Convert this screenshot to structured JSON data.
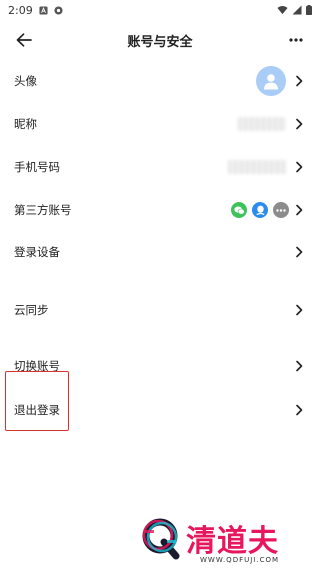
{
  "status_bar": {
    "time": "2:09"
  },
  "header": {
    "title": "账号与安全"
  },
  "rows": [
    {
      "label": "头像"
    },
    {
      "label": "昵称"
    },
    {
      "label": "手机号码"
    },
    {
      "label": "第三方账号"
    },
    {
      "label": "登录设备"
    },
    {
      "label": "云同步"
    },
    {
      "label": "切换账号"
    },
    {
      "label": "退出登录"
    }
  ],
  "third_party_icons": [
    "wechat-icon",
    "qq-icon",
    "more-dots-icon"
  ],
  "colors": {
    "wechat": "#3ec35c",
    "qq": "#2b8cf0",
    "more": "#8c8c8c",
    "avatar_bg": "#a9cdf6",
    "highlight": "#d9312b",
    "watermark": "#e8175d"
  },
  "watermark": {
    "brand": "清道夫",
    "url": "WWW.QDFUJI.COM"
  }
}
